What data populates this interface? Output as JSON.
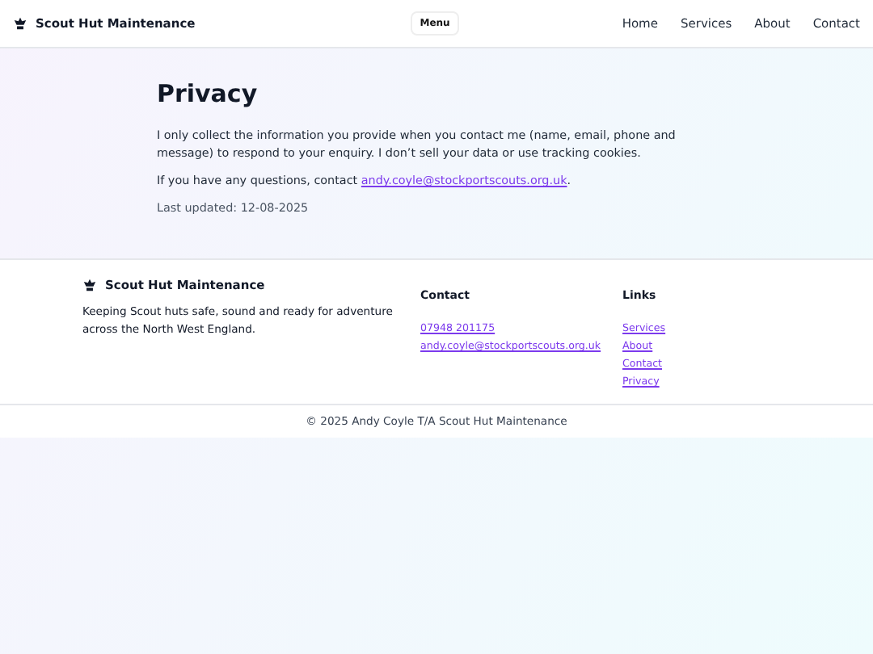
{
  "header": {
    "brand": "Scout Hut Maintenance",
    "menu_button": "Menu",
    "nav": [
      "Home",
      "Services",
      "About",
      "Contact"
    ]
  },
  "main": {
    "title": "Privacy",
    "paragraph": "I only collect the information you provide when you contact me (name, email, phone and message) to respond to your enquiry. I don’t sell your data or use tracking cookies.",
    "contact_prefix": "If you have any questions, contact ",
    "contact_email": "andy.coyle@stockportscouts.org.uk",
    "contact_suffix": ".",
    "updated": "Last updated: 12-08-2025"
  },
  "footer": {
    "brand": "Scout Hut Maintenance",
    "tagline": "Keeping Scout huts safe, sound and ready for adventure across the North West England.",
    "contact_heading": "Contact",
    "phone": "07948 201175",
    "email": "andy.coyle@stockportscouts.org.uk",
    "links_heading": "Links",
    "links": [
      "Services",
      "About",
      "Contact",
      "Privacy"
    ],
    "copyright": "© 2025 Andy Coyle T/A Scout Hut Maintenance"
  }
}
